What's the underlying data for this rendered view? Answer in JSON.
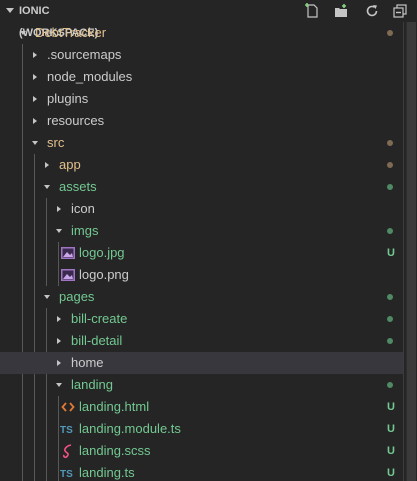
{
  "header": {
    "title": "IONIC (WORKSPACE)",
    "actions": [
      {
        "name": "new-file-icon"
      },
      {
        "name": "new-folder-icon"
      },
      {
        "name": "refresh-icon"
      },
      {
        "name": "collapse-all-icon"
      }
    ]
  },
  "colors": {
    "background": "#252526",
    "modified_dot": "#7f6b54",
    "untracked_dot": "#4e8a63",
    "untracked_text": "#73c991",
    "folder_modified_text": "#e2c08d",
    "default_text": "#cccccc",
    "selected_row": "#37373d"
  },
  "tree": [
    {
      "label": "DebtTracker",
      "depth": 0,
      "type": "folder",
      "expanded": true,
      "status": "modified"
    },
    {
      "label": ".sourcemaps",
      "depth": 1,
      "type": "folder",
      "expanded": false,
      "status": "none"
    },
    {
      "label": "node_modules",
      "depth": 1,
      "type": "folder",
      "expanded": false,
      "status": "none"
    },
    {
      "label": "plugins",
      "depth": 1,
      "type": "folder",
      "expanded": false,
      "status": "none"
    },
    {
      "label": "resources",
      "depth": 1,
      "type": "folder",
      "expanded": false,
      "status": "none"
    },
    {
      "label": "src",
      "depth": 1,
      "type": "folder",
      "expanded": true,
      "status": "modified"
    },
    {
      "label": "app",
      "depth": 2,
      "type": "folder",
      "expanded": false,
      "status": "modified"
    },
    {
      "label": "assets",
      "depth": 2,
      "type": "folder",
      "expanded": true,
      "status": "untracked"
    },
    {
      "label": "icon",
      "depth": 3,
      "type": "folder",
      "expanded": false,
      "status": "none"
    },
    {
      "label": "imgs",
      "depth": 3,
      "type": "folder",
      "expanded": true,
      "status": "untracked"
    },
    {
      "label": "logo.jpg",
      "depth": 4,
      "type": "file",
      "icon": "image-icon",
      "status": "untracked",
      "badge": "U"
    },
    {
      "label": "logo.png",
      "depth": 4,
      "type": "file",
      "icon": "image-icon",
      "status": "none"
    },
    {
      "label": "pages",
      "depth": 2,
      "type": "folder",
      "expanded": true,
      "status": "untracked"
    },
    {
      "label": "bill-create",
      "depth": 3,
      "type": "folder",
      "expanded": false,
      "status": "untracked"
    },
    {
      "label": "bill-detail",
      "depth": 3,
      "type": "folder",
      "expanded": false,
      "status": "untracked"
    },
    {
      "label": "home",
      "depth": 3,
      "type": "folder",
      "expanded": false,
      "status": "none",
      "selected": true
    },
    {
      "label": "landing",
      "depth": 3,
      "type": "folder",
      "expanded": true,
      "status": "untracked"
    },
    {
      "label": "landing.html",
      "depth": 4,
      "type": "file",
      "icon": "html-icon",
      "status": "untracked",
      "badge": "U"
    },
    {
      "label": "landing.module.ts",
      "depth": 4,
      "type": "file",
      "icon": "typescript-icon",
      "status": "untracked",
      "badge": "U"
    },
    {
      "label": "landing.scss",
      "depth": 4,
      "type": "file",
      "icon": "sass-icon",
      "status": "untracked",
      "badge": "U"
    },
    {
      "label": "landing.ts",
      "depth": 4,
      "type": "file",
      "icon": "typescript-icon",
      "status": "untracked",
      "badge": "U"
    }
  ]
}
